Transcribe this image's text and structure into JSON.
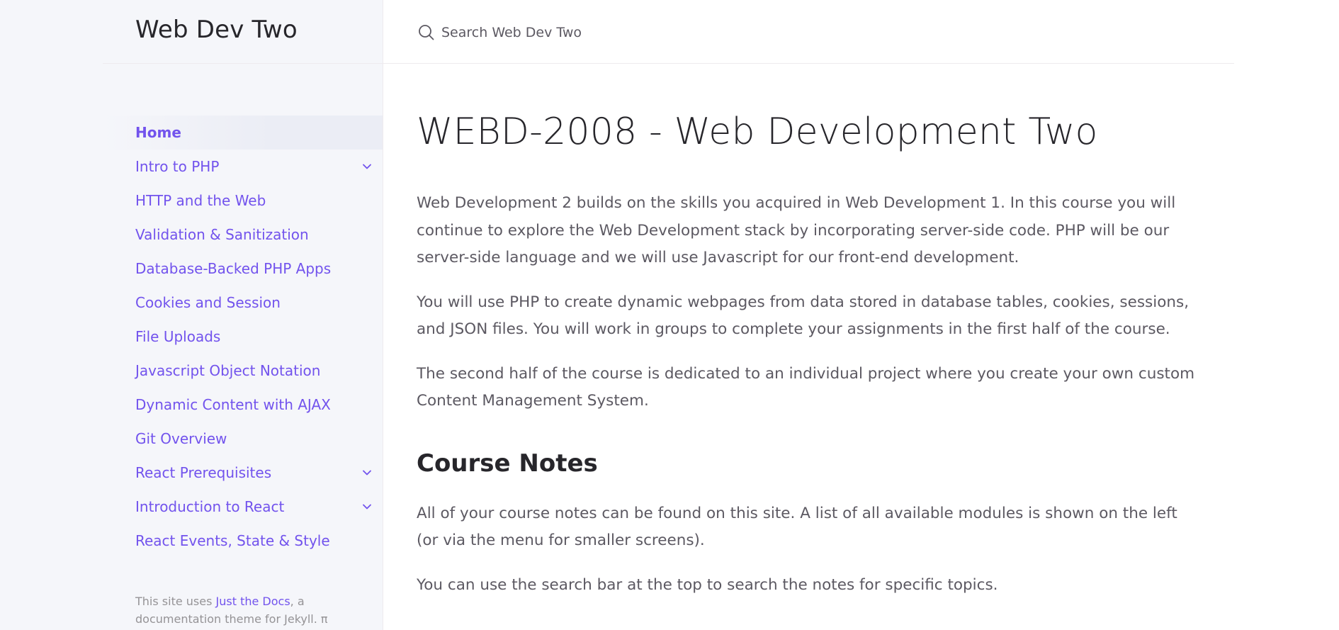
{
  "site": {
    "title": "Web Dev Two"
  },
  "search": {
    "placeholder": "Search Web Dev Two",
    "icon": "search-icon"
  },
  "sidebar": {
    "items": [
      {
        "label": "Home",
        "active": true,
        "expandable": false
      },
      {
        "label": "Intro to PHP",
        "active": false,
        "expandable": true
      },
      {
        "label": "HTTP and the Web",
        "active": false,
        "expandable": false
      },
      {
        "label": "Validation & Sanitization",
        "active": false,
        "expandable": false
      },
      {
        "label": "Database-Backed PHP Apps",
        "active": false,
        "expandable": false
      },
      {
        "label": "Cookies and Session",
        "active": false,
        "expandable": false
      },
      {
        "label": "File Uploads",
        "active": false,
        "expandable": false
      },
      {
        "label": "Javascript Object Notation",
        "active": false,
        "expandable": false
      },
      {
        "label": "Dynamic Content with AJAX",
        "active": false,
        "expandable": false
      },
      {
        "label": "Git Overview",
        "active": false,
        "expandable": false
      },
      {
        "label": "React Prerequisites",
        "active": false,
        "expandable": true
      },
      {
        "label": "Introduction to React",
        "active": false,
        "expandable": true
      },
      {
        "label": "React Events, State & Style",
        "active": false,
        "expandable": false
      }
    ],
    "footer": {
      "prefix": "This site uses ",
      "link": "Just the Docs",
      "suffix": ", a documentation theme for Jekyll. π"
    }
  },
  "main": {
    "title": "WEBD-2008 - Web Development Two",
    "intro_paragraphs": [
      "Web Development 2 builds on the skills you acquired in Web Development 1. In this course you will continue to explore the Web Development stack by incorporating server-side code. PHP will be our server-side language and we will use Javascript for our front-end development.",
      "You will use PHP to create dynamic webpages from data stored in database tables, cookies, sessions, and JSON files. You will work in groups to complete your assignments in the first half of the course.",
      "The second half of the course is dedicated to an individual project where you create your own custom Content Management System."
    ],
    "section": {
      "heading": "Course Notes",
      "paragraphs": [
        "All of your course notes can be found on this site. A list of all available modules is shown on the left (or via the menu for smaller screens).",
        "You can use the search bar at the top to search the notes for specific topics."
      ]
    }
  },
  "colors": {
    "accent": "#7253ed",
    "heading": "#27262b",
    "body_text": "#5c5962",
    "sidebar_bg": "#f5f6fa",
    "active_item_bg": "#ebedf5",
    "muted": "#959396"
  }
}
